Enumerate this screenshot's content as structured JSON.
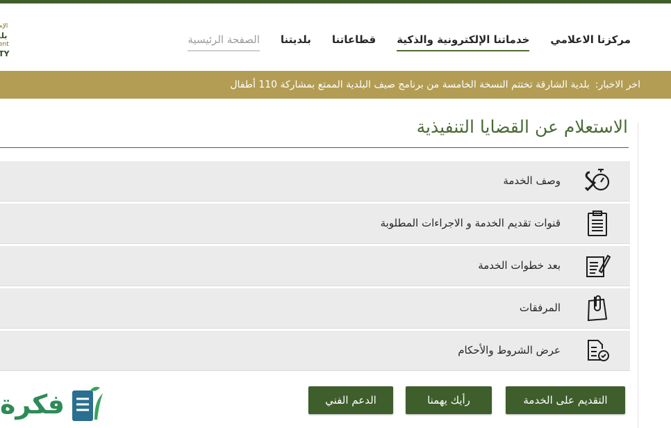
{
  "nav": {
    "home": "الصفحة الرئيسية",
    "municipality": "بلديتنا",
    "sectors": "قطاعاتنا",
    "eservices": "خدماتنا الإلكترونية والذكية",
    "media": "مركزنا الاعلامي"
  },
  "news": {
    "label": "اخر الاخبار:",
    "headline": "بلدية الشارقة تختتم النسخة الخامسة من برنامج صيف البلدية الممتع بمشاركة 110 أطفال"
  },
  "logo": {
    "line1": "الإم",
    "line2": "بلـ",
    "line3": "ent",
    "line4": "TY"
  },
  "page_title": "الاستعلام عن القضايا التنفيذية",
  "sections": [
    {
      "label": "وصف الخدمة",
      "icon": "tools-stopwatch-icon"
    },
    {
      "label": "قنوات تقديم الخدمة و الاجراءات المطلوبة",
      "icon": "clipboard-icon"
    },
    {
      "label": "بعد خطوات الخدمة",
      "icon": "document-pen-icon"
    },
    {
      "label": "المرفقات",
      "icon": "paperclip-icon"
    },
    {
      "label": "عرض الشروط والأحكام",
      "icon": "checklist-icon"
    }
  ],
  "buttons": {
    "apply": "التقديم على الخدمة",
    "feedback": "رأيك يهمنا",
    "support": "الدعم الفني"
  },
  "watermark": {
    "text": "فكرة"
  },
  "colors": {
    "accent_green": "#3e5e2c",
    "news_gold": "#b39d55",
    "title_green": "#4a6a35"
  }
}
